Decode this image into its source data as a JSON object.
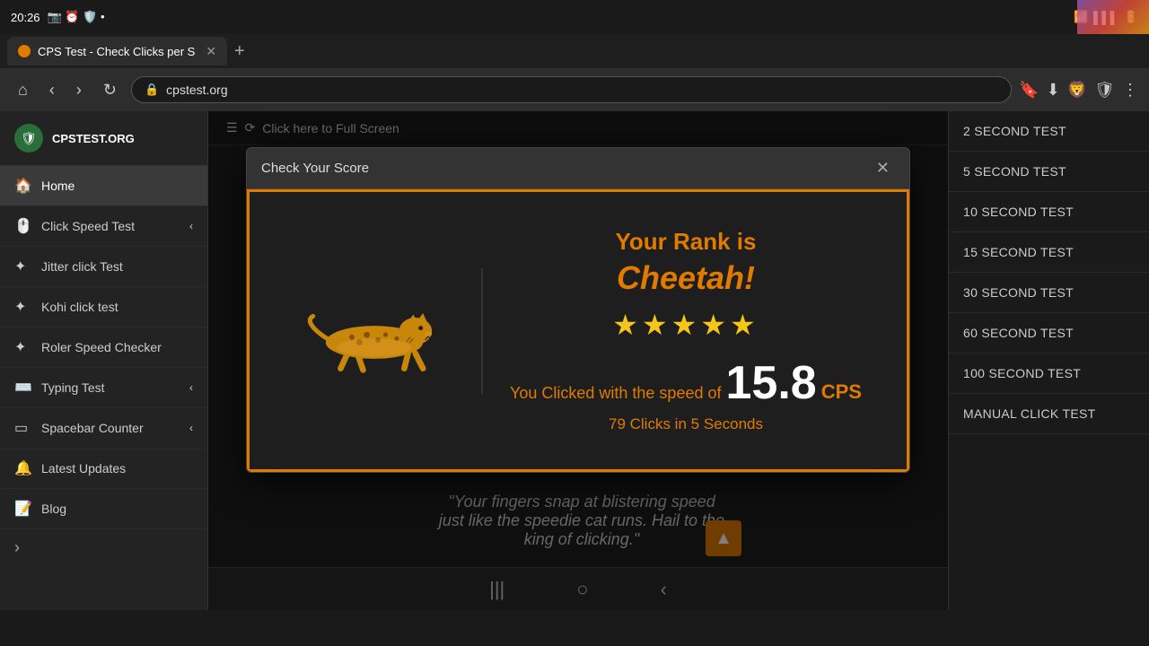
{
  "statusBar": {
    "time": "20:26",
    "url": "cpstest.org"
  },
  "tab": {
    "title": "CPS Test - Check Clicks per S",
    "favicon": "🟠"
  },
  "logo": {
    "text": "CPSTEST.ORG"
  },
  "sidebar": {
    "items": [
      {
        "label": "Home",
        "icon": "🏠",
        "active": true
      },
      {
        "label": "Click Speed Test",
        "icon": "🖱️",
        "chevron": "‹"
      },
      {
        "label": "Jitter click Test",
        "icon": "✦"
      },
      {
        "label": "Kohi click test",
        "icon": "✦"
      },
      {
        "label": "Roler Speed Checker",
        "icon": "✦"
      },
      {
        "label": "Typing Test",
        "icon": "⌨️",
        "chevron": "‹"
      },
      {
        "label": "Spacebar Counter",
        "icon": "▭",
        "chevron": "‹"
      },
      {
        "label": "Latest Updates",
        "icon": "🔔"
      },
      {
        "label": "Blog",
        "icon": "📝"
      }
    ]
  },
  "fullscreenBar": {
    "label": "Click here to Full Screen"
  },
  "rightSidebar": {
    "items": [
      "2 SECOND TEST",
      "5 SECOND TEST",
      "10 SECOND TEST",
      "15 SECOND TEST",
      "30 SECOND TEST",
      "60 SECOND TEST",
      "100 SECOND TEST",
      "MANUAL CLICK TEST"
    ]
  },
  "modal": {
    "title": "Check Your Score",
    "rankLabel": "Your Rank is",
    "rankName": "Cheetah!",
    "stars": "★★★★★",
    "speedLabel": "You Clicked with the speed of",
    "speedValue": "15.8",
    "speedUnit": "CPS",
    "clicksInfo": "79 Clicks in 5 Seconds"
  },
  "quote": {
    "text": "\"Your fingers snap at blistering speed just like the speedie cat runs. Hail to the king of clicking.\""
  },
  "scrollTop": "▲"
}
